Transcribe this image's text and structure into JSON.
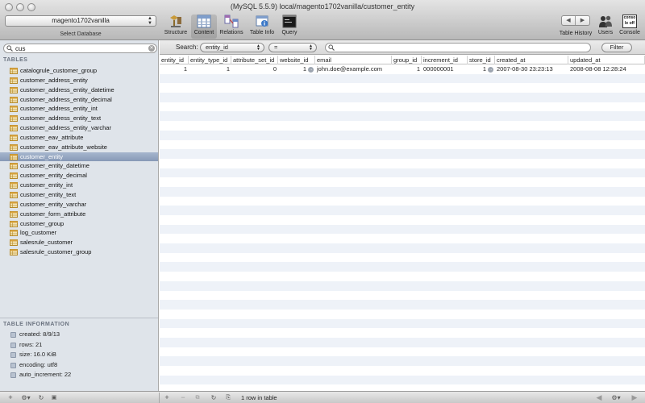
{
  "window": {
    "title": "(MySQL 5.5.9) local/magento1702vanilla/customer_entity"
  },
  "toolbar": {
    "database": "magento1702vanilla",
    "database_caption": "Select Database",
    "structure": "Structure",
    "content": "Content",
    "relations": "Relations",
    "table_info": "Table Info",
    "query": "Query",
    "table_history": "Table History",
    "users": "Users",
    "console": "Console",
    "console_icon_text_top": "conso",
    "console_icon_text_bottom": "le off"
  },
  "sidebar": {
    "filter_value": "cus",
    "tables_heading": "TABLES",
    "tables": [
      "catalogrule_customer_group",
      "customer_address_entity",
      "customer_address_entity_datetime",
      "customer_address_entity_decimal",
      "customer_address_entity_int",
      "customer_address_entity_text",
      "customer_address_entity_varchar",
      "customer_eav_attribute",
      "customer_eav_attribute_website",
      "customer_entity",
      "customer_entity_datetime",
      "customer_entity_decimal",
      "customer_entity_int",
      "customer_entity_text",
      "customer_entity_varchar",
      "customer_form_attribute",
      "customer_group",
      "log_customer",
      "salesrule_customer",
      "salesrule_customer_group"
    ],
    "selected_table": "customer_entity",
    "info_heading": "TABLE INFORMATION",
    "info": [
      "created: 8/9/13",
      "rows: 21",
      "size: 16.0 KiB",
      "encoding: utf8",
      "auto_increment: 22"
    ]
  },
  "search": {
    "label": "Search:",
    "field": "entity_id",
    "operator": "=",
    "value": "",
    "filter_button": "Filter"
  },
  "grid": {
    "columns": [
      "entity_id",
      "entity_type_id",
      "attribute_set_id",
      "website_id",
      "email",
      "group_id",
      "increment_id",
      "store_id",
      "created_at",
      "updated_at"
    ],
    "rows": [
      [
        "1",
        "1",
        "0",
        "1",
        "john.doe@example.com",
        "1",
        "000000001",
        "1",
        "2007-08-30 23:23:13",
        "2008-08-08 12:28:24"
      ]
    ]
  },
  "status": {
    "row_count": "1 row in table"
  }
}
